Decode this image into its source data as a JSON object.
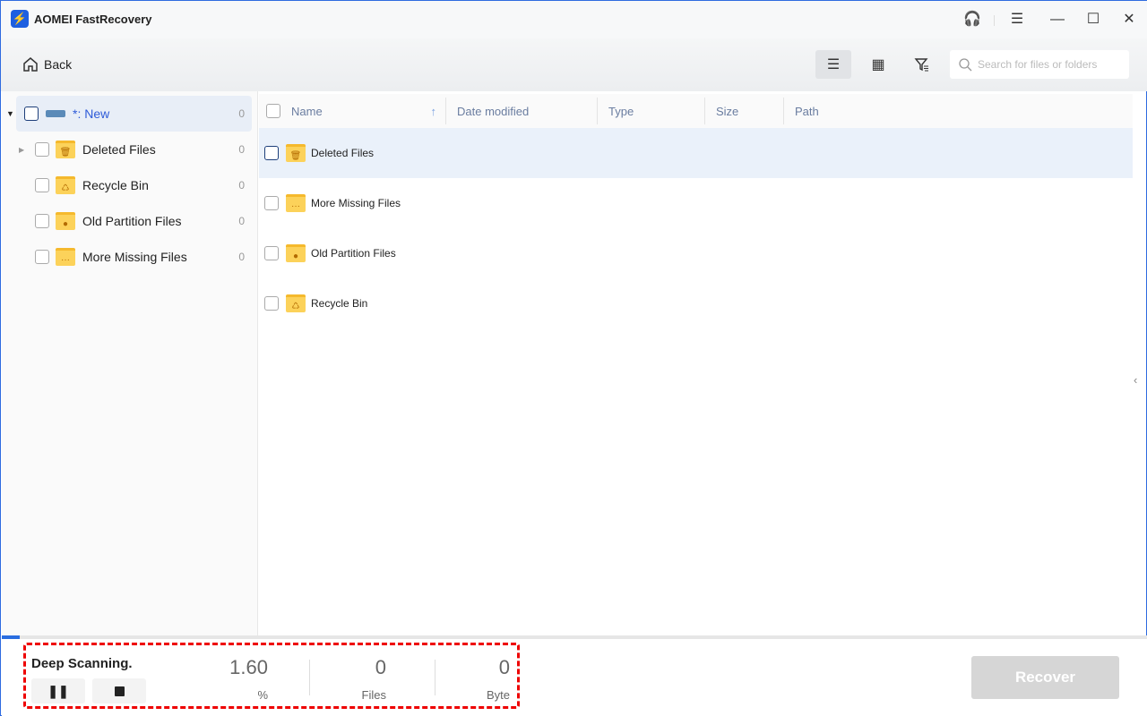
{
  "app": {
    "title": "AOMEI FastRecovery"
  },
  "toolbar": {
    "back_label": "Back",
    "search_placeholder": "Search for files or folders"
  },
  "sidebar": {
    "root": {
      "label": "*: New",
      "count": "0"
    },
    "items": [
      {
        "label": "Deleted Files",
        "count": "0",
        "icon": "trash"
      },
      {
        "label": "Recycle Bin",
        "count": "0",
        "icon": "recycle"
      },
      {
        "label": "Old Partition Files",
        "count": "0",
        "icon": "clock"
      },
      {
        "label": "More Missing Files",
        "count": "0",
        "icon": "dots"
      }
    ]
  },
  "table": {
    "columns": [
      "Name",
      "Date modified",
      "Type",
      "Size",
      "Path"
    ],
    "rows": [
      {
        "name": "Deleted Files",
        "icon": "trash"
      },
      {
        "name": "More Missing Files",
        "icon": "dots"
      },
      {
        "name": "Old Partition Files",
        "icon": "clock"
      },
      {
        "name": "Recycle Bin",
        "icon": "recycle"
      }
    ]
  },
  "scan": {
    "status": "Deep Scanning.",
    "percent": "1.60",
    "percent_label": "%",
    "files": "0",
    "files_label": "Files",
    "bytes": "0",
    "bytes_label": "Byte",
    "progress": 1.6
  },
  "footer": {
    "recover_label": "Recover"
  },
  "colors": {
    "accent": "#2a6de0",
    "highlight": "#e00000"
  }
}
